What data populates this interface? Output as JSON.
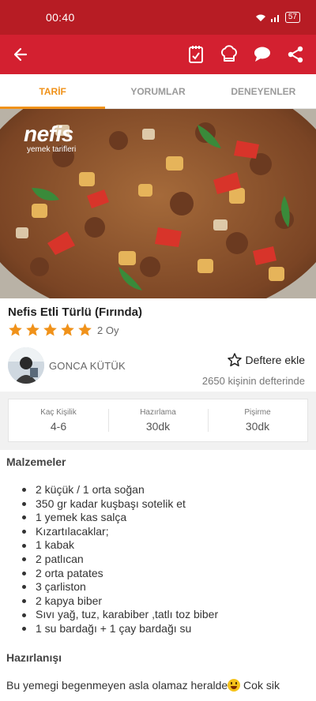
{
  "status_bar": {
    "time": "00:40",
    "battery": "57"
  },
  "app_bar": {
    "icons": [
      "back-arrow-icon",
      "notebook-check-icon",
      "chef-hat-icon",
      "chat-bubble-icon",
      "share-icon"
    ],
    "color": "#d32030"
  },
  "tabs": [
    {
      "label": "TARİF",
      "active": true
    },
    {
      "label": "YORUMLAR",
      "active": false
    },
    {
      "label": "DENEYENLER",
      "active": false
    }
  ],
  "hero": {
    "brand": "nefis",
    "brand_sub": "yemek tarifleri"
  },
  "recipe": {
    "title": "Nefis Etli Türlü (Fırında)",
    "rating": 5,
    "votes_text": "2 Oy",
    "accent_color": "#f0921a"
  },
  "author": {
    "name": "GONCA KÜTÜK"
  },
  "bookmark": {
    "label": "Deftere ekle",
    "count_text": "2650 kişinin defterinde"
  },
  "stats": [
    {
      "label": "Kaç Kişilik",
      "value": "4-6"
    },
    {
      "label": "Hazırlama",
      "value": "30dk"
    },
    {
      "label": "Pişirme",
      "value": "30dk"
    }
  ],
  "ingredients": {
    "heading": "Malzemeler",
    "items": [
      "2 küçük / 1 orta soğan",
      "350 gr kadar kuşbaşı sotelik et",
      "1 yemek kas salça",
      "Kızartılacaklar;",
      "1 kabak",
      "2 patlıcan",
      "2 orta patates",
      "3 çarliston",
      "2 kapya biber",
      "Sıvı yağ, tuz, karabiber ,tatlı toz biber",
      "1 su bardağı + 1 çay bardağı su"
    ]
  },
  "preparation": {
    "heading": "Hazırlanışı",
    "text_start": "Bu yemegi begenmeyen asla olamaz heralde",
    "text_end": " Cok sik"
  }
}
